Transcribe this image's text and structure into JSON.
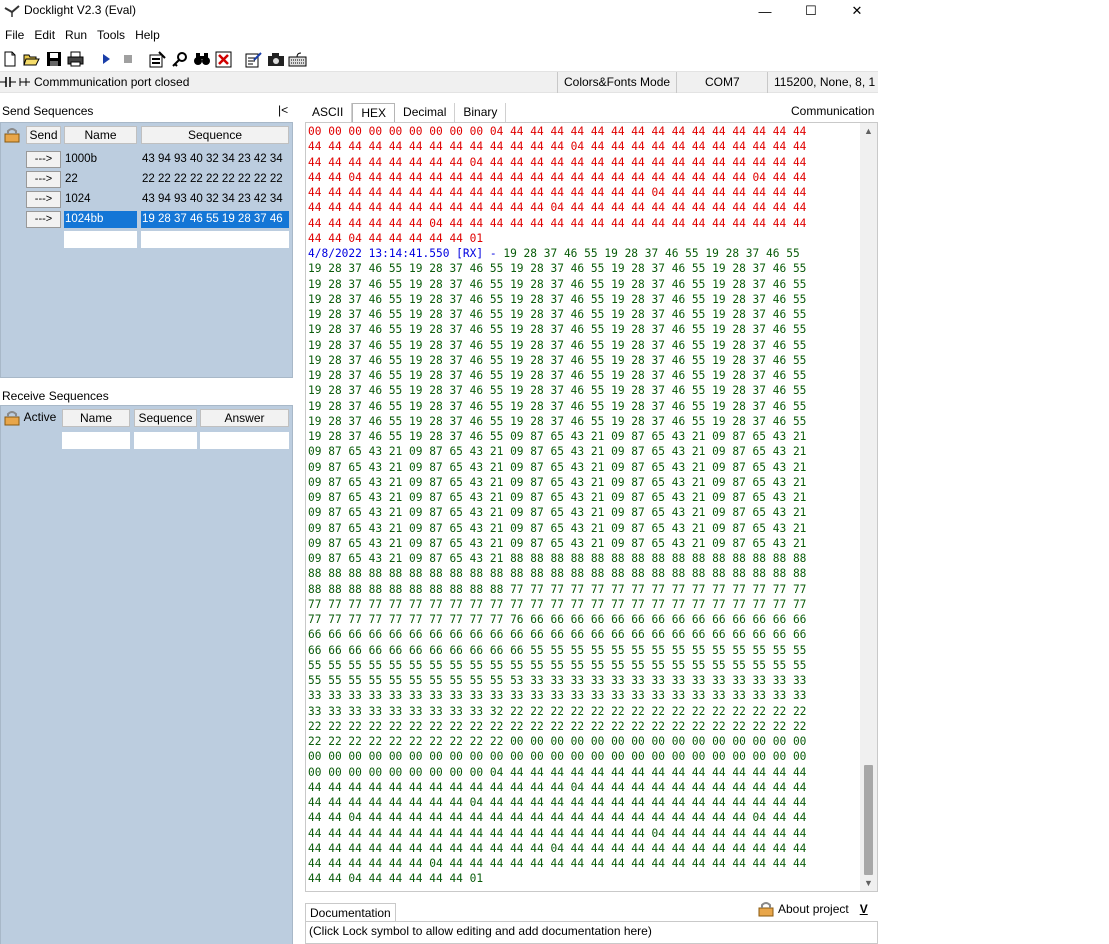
{
  "window": {
    "title": "Docklight V2.3 (Eval)",
    "controls": [
      "—",
      "☐",
      "✕"
    ]
  },
  "menu": [
    "File",
    "Edit",
    "Run",
    "Tools",
    "Help"
  ],
  "status": {
    "message": "Commmunication port closed",
    "mode": "Colors&Fonts Mode",
    "port": "COM7",
    "settings": "115200, None, 8, 1"
  },
  "send_panel": {
    "title": "Send Sequences",
    "collapse": "|<",
    "headers": {
      "send": "Send",
      "name": "Name",
      "sequence": "Sequence"
    },
    "rows": [
      {
        "button": "--->",
        "name": "1000b",
        "sequence": "43 94 93 40 32 34 23 42 34"
      },
      {
        "button": "--->",
        "name": "22",
        "sequence": "22 22 22 22 22 22 22 22 22"
      },
      {
        "button": "--->",
        "name": "1024",
        "sequence": "43 94 93 40 32 34 23 42 34"
      },
      {
        "button": "--->",
        "name": "1024bb",
        "sequence": "19 28 37 46 55 19 28 37 46"
      }
    ]
  },
  "receive_panel": {
    "title": "Receive Sequences",
    "headers": {
      "active": "Active",
      "name": "Name",
      "sequence": "Sequence",
      "answer": "Answer"
    }
  },
  "tabs": [
    "ASCII",
    "HEX",
    "Decimal",
    "Binary"
  ],
  "active_tab": "HEX",
  "comm_label": "Communication",
  "comm_lines": [
    {
      "c": "tx",
      "t": "00 00 00 00 00 00 00 00 00 04 44 44 44 44 44 44 44 44 44 44 44 44 44 44 44"
    },
    {
      "c": "tx",
      "t": "44 44 44 44 44 44 44 44 44 44 44 44 44 04 44 44 44 44 44 44 44 44 44 44 44"
    },
    {
      "c": "tx",
      "t": "44 44 44 44 44 44 44 44 04 44 44 44 44 44 44 44 44 44 44 44 44 44 44 44 44"
    },
    {
      "c": "tx",
      "t": "44 44 04 44 44 44 44 44 44 44 44 44 44 44 44 44 44 44 44 44 44 44 04 44 44"
    },
    {
      "c": "tx",
      "t": "44 44 44 44 44 44 44 44 44 44 44 44 44 44 44 44 44 04 44 44 44 44 44 44 44"
    },
    {
      "c": "tx",
      "t": "44 44 44 44 44 44 44 44 44 44 44 44 04 44 44 44 44 44 44 44 44 44 44 44 44"
    },
    {
      "c": "tx",
      "t": "44 44 44 44 44 44 04 44 44 44 44 44 44 44 44 44 44 44 44 44 44 44 44 44 44"
    },
    {
      "c": "tx",
      "t": "44 44 04 44 44 44 44 44 01"
    },
    {
      "c": "ts",
      "t": "4/8/2022 13:14:41.550 [RX] - ",
      "rx": "19 28 37 46 55 19 28 37 46 55 19 28 37 46 55"
    },
    {
      "c": "rx",
      "t": "19 28 37 46 55 19 28 37 46 55 19 28 37 46 55 19 28 37 46 55 19 28 37 46 55"
    },
    {
      "c": "rx",
      "t": "19 28 37 46 55 19 28 37 46 55 19 28 37 46 55 19 28 37 46 55 19 28 37 46 55"
    },
    {
      "c": "rx",
      "t": "19 28 37 46 55 19 28 37 46 55 19 28 37 46 55 19 28 37 46 55 19 28 37 46 55"
    },
    {
      "c": "rx",
      "t": "19 28 37 46 55 19 28 37 46 55 19 28 37 46 55 19 28 37 46 55 19 28 37 46 55"
    },
    {
      "c": "rx",
      "t": "19 28 37 46 55 19 28 37 46 55 19 28 37 46 55 19 28 37 46 55 19 28 37 46 55"
    },
    {
      "c": "rx",
      "t": "19 28 37 46 55 19 28 37 46 55 19 28 37 46 55 19 28 37 46 55 19 28 37 46 55"
    },
    {
      "c": "rx",
      "t": "19 28 37 46 55 19 28 37 46 55 19 28 37 46 55 19 28 37 46 55 19 28 37 46 55"
    },
    {
      "c": "rx",
      "t": "19 28 37 46 55 19 28 37 46 55 19 28 37 46 55 19 28 37 46 55 19 28 37 46 55"
    },
    {
      "c": "rx",
      "t": "19 28 37 46 55 19 28 37 46 55 19 28 37 46 55 19 28 37 46 55 19 28 37 46 55"
    },
    {
      "c": "rx",
      "t": "19 28 37 46 55 19 28 37 46 55 19 28 37 46 55 19 28 37 46 55 19 28 37 46 55"
    },
    {
      "c": "rx",
      "t": "19 28 37 46 55 19 28 37 46 55 19 28 37 46 55 19 28 37 46 55 19 28 37 46 55"
    },
    {
      "c": "rx",
      "t": "19 28 37 46 55 19 28 37 46 55 09 87 65 43 21 09 87 65 43 21 09 87 65 43 21"
    },
    {
      "c": "rx",
      "t": "09 87 65 43 21 09 87 65 43 21 09 87 65 43 21 09 87 65 43 21 09 87 65 43 21"
    },
    {
      "c": "rx",
      "t": "09 87 65 43 21 09 87 65 43 21 09 87 65 43 21 09 87 65 43 21 09 87 65 43 21"
    },
    {
      "c": "rx",
      "t": "09 87 65 43 21 09 87 65 43 21 09 87 65 43 21 09 87 65 43 21 09 87 65 43 21"
    },
    {
      "c": "rx",
      "t": "09 87 65 43 21 09 87 65 43 21 09 87 65 43 21 09 87 65 43 21 09 87 65 43 21"
    },
    {
      "c": "rx",
      "t": "09 87 65 43 21 09 87 65 43 21 09 87 65 43 21 09 87 65 43 21 09 87 65 43 21"
    },
    {
      "c": "rx",
      "t": "09 87 65 43 21 09 87 65 43 21 09 87 65 43 21 09 87 65 43 21 09 87 65 43 21"
    },
    {
      "c": "rx",
      "t": "09 87 65 43 21 09 87 65 43 21 09 87 65 43 21 09 87 65 43 21 09 87 65 43 21"
    },
    {
      "c": "rx",
      "t": "09 87 65 43 21 09 87 65 43 21 88 88 88 88 88 88 88 88 88 88 88 88 88 88 88"
    },
    {
      "c": "rx",
      "t": "88 88 88 88 88 88 88 88 88 88 88 88 88 88 88 88 88 88 88 88 88 88 88 88 88"
    },
    {
      "c": "rx",
      "t": "88 88 88 88 88 88 88 88 88 88 77 77 77 77 77 77 77 77 77 77 77 77 77 77 77"
    },
    {
      "c": "rx",
      "t": "77 77 77 77 77 77 77 77 77 77 77 77 77 77 77 77 77 77 77 77 77 77 77 77 77"
    },
    {
      "c": "rx",
      "t": "77 77 77 77 77 77 77 77 77 77 76 66 66 66 66 66 66 66 66 66 66 66 66 66 66"
    },
    {
      "c": "rx",
      "t": "66 66 66 66 66 66 66 66 66 66 66 66 66 66 66 66 66 66 66 66 66 66 66 66 66"
    },
    {
      "c": "rx",
      "t": "66 66 66 66 66 66 66 66 66 66 66 55 55 55 55 55 55 55 55 55 55 55 55 55 55"
    },
    {
      "c": "rx",
      "t": "55 55 55 55 55 55 55 55 55 55 55 55 55 55 55 55 55 55 55 55 55 55 55 55 55"
    },
    {
      "c": "rx",
      "t": "55 55 55 55 55 55 55 55 55 55 53 33 33 33 33 33 33 33 33 33 33 33 33 33 33"
    },
    {
      "c": "rx",
      "t": "33 33 33 33 33 33 33 33 33 33 33 33 33 33 33 33 33 33 33 33 33 33 33 33 33"
    },
    {
      "c": "rx",
      "t": "33 33 33 33 33 33 33 33 33 32 22 22 22 22 22 22 22 22 22 22 22 22 22 22 22"
    },
    {
      "c": "rx",
      "t": "22 22 22 22 22 22 22 22 22 22 22 22 22 22 22 22 22 22 22 22 22 22 22 22 22"
    },
    {
      "c": "rx",
      "t": "22 22 22 22 22 22 22 22 22 22 00 00 00 00 00 00 00 00 00 00 00 00 00 00 00"
    },
    {
      "c": "rx",
      "t": "00 00 00 00 00 00 00 00 00 00 00 00 00 00 00 00 00 00 00 00 00 00 00 00 00"
    },
    {
      "c": "rx",
      "t": "00 00 00 00 00 00 00 00 00 04 44 44 44 44 44 44 44 44 44 44 44 44 44 44 44"
    },
    {
      "c": "rx",
      "t": "44 44 44 44 44 44 44 44 44 44 44 44 44 04 44 44 44 44 44 44 44 44 44 44 44"
    },
    {
      "c": "rx",
      "t": "44 44 44 44 44 44 44 44 04 44 44 44 44 44 44 44 44 44 44 44 44 44 44 44 44"
    },
    {
      "c": "rx",
      "t": "44 44 04 44 44 44 44 44 44 44 44 44 44 44 44 44 44 44 44 44 44 44 04 44 44"
    },
    {
      "c": "rx",
      "t": "44 44 44 44 44 44 44 44 44 44 44 44 44 44 44 44 44 04 44 44 44 44 44 44 44"
    },
    {
      "c": "rx",
      "t": "44 44 44 44 44 44 44 44 44 44 44 44 04 44 44 44 44 44 44 44 44 44 44 44 44"
    },
    {
      "c": "rx",
      "t": "44 44 44 44 44 44 04 44 44 44 44 44 44 44 44 44 44 44 44 44 44 44 44 44 44"
    },
    {
      "c": "rx",
      "t": "44 44 04 44 44 44 44 44 01"
    }
  ],
  "documentation": {
    "tab": "Documentation",
    "about": "About project",
    "collapse": "V",
    "hint": "(Click Lock symbol to allow editing and add documentation here)"
  },
  "colors": {
    "tx": "#e00000",
    "rx": "#0a5c0a",
    "timestamp": "#0000e0",
    "selection": "#1476d6",
    "panel_bg": "#bccddf"
  }
}
